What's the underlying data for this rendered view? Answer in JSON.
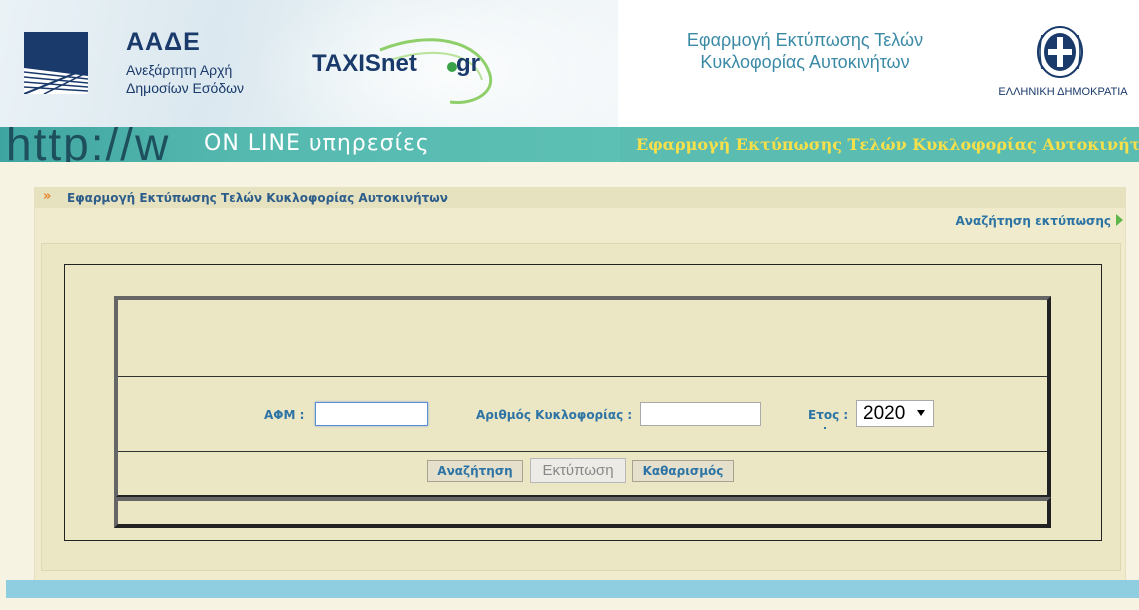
{
  "header": {
    "aade_title": "ΑΑΔΕ",
    "aade_subtitle_line1": "Ανεξάρτητη Αρχή",
    "aade_subtitle_line2": "Δημοσίων Εσόδων",
    "taxisnet_name": "TAXISnet",
    "taxisnet_tld": "gr",
    "app_title_line1": "Εφαρμογή Εκτύπωσης Τελών",
    "app_title_line2": "Κυκλοφορίας Αυτοκινήτων",
    "government": "ΕΛΛΗΝΙΚΗ ΔΗΜΟΚΡΑΤΙΑ"
  },
  "banner": {
    "http_text": "http://w",
    "online_text": "ON LINE υπηρεσίες",
    "title": "Εφαρμογή Εκτύπωσης Τελών Κυκλοφορίας Αυτοκινήτων"
  },
  "breadcrumb": {
    "label": "Εφαρμογή Εκτύπωσης Τελών Κυκλοφορίας Αυτοκινήτων"
  },
  "nav": {
    "search_print_link": "Αναζήτηση εκτύπωσης"
  },
  "form": {
    "afm_label": "ΑΦΜ :",
    "afm_value": "",
    "plate_label": "Αριθμός Κυκλοφορίας :",
    "plate_value": "",
    "year_label": "Ετος :",
    "year_selected": "2020",
    "search_button": "Αναζήτηση",
    "print_button": "Εκτύπωση",
    "clear_button": "Καθαρισμός"
  },
  "colors": {
    "accent_blue": "#2d74a5",
    "banner_teal": "#5bbdb1",
    "banner_title": "#f7e04a",
    "panel_bg": "#ebe6c4"
  }
}
